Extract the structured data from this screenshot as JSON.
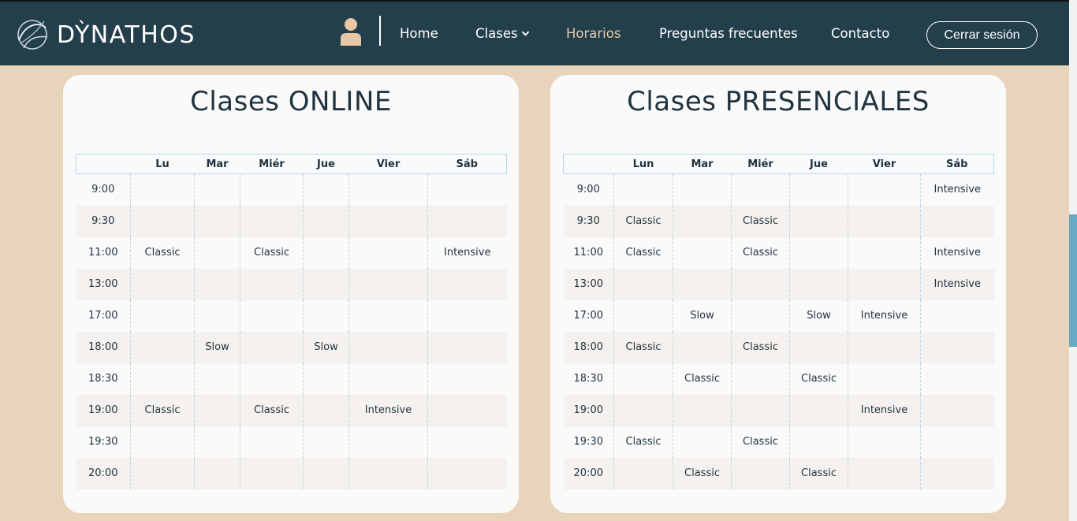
{
  "nav": {
    "brand": "DỲNATHOS",
    "links": {
      "home": "Home",
      "clases": "Clases",
      "horarios": "Horarios",
      "faq": "Preguntas frecuentes",
      "contacto": "Contacto"
    },
    "logout": "Cerrar sesión",
    "active": "horarios",
    "colors": {
      "bar": "#243f4c",
      "active": "#e8c7a6",
      "background": "#e8d3bb"
    }
  },
  "online": {
    "title": "Clases ONLINE",
    "headers": [
      "",
      "Lu",
      "Mar",
      "Miér",
      "Jue",
      "Vier",
      "Sáb"
    ],
    "rows": [
      [
        "9:00",
        "",
        "",
        "",
        "",
        "",
        ""
      ],
      [
        "9:30",
        "",
        "",
        "",
        "",
        "",
        ""
      ],
      [
        "11:00",
        "Classic",
        "",
        "Classic",
        "",
        "",
        "Intensive"
      ],
      [
        "13:00",
        "",
        "",
        "",
        "",
        "",
        ""
      ],
      [
        "17:00",
        "",
        "",
        "",
        "",
        "",
        ""
      ],
      [
        "18:00",
        "",
        "Slow",
        "",
        "Slow",
        "",
        ""
      ],
      [
        "18:30",
        "",
        "",
        "",
        "",
        "",
        ""
      ],
      [
        "19:00",
        "Classic",
        "",
        "Classic",
        "",
        "Intensive",
        ""
      ],
      [
        "19:30",
        "",
        "",
        "",
        "",
        "",
        ""
      ],
      [
        "20:00",
        "",
        "",
        "",
        "",
        "",
        ""
      ]
    ]
  },
  "presencial": {
    "title": "Clases PRESENCIALES",
    "headers": [
      "",
      "Lun",
      "Mar",
      "Miér",
      "Jue",
      "Vier",
      "Sáb"
    ],
    "rows": [
      [
        "9:00",
        "",
        "",
        "",
        "",
        "",
        "Intensive"
      ],
      [
        "9:30",
        "Classic",
        "",
        "Classic",
        "",
        "",
        ""
      ],
      [
        "11:00",
        "Classic",
        "",
        "Classic",
        "",
        "",
        "Intensive"
      ],
      [
        "13:00",
        "",
        "",
        "",
        "",
        "",
        "Intensive"
      ],
      [
        "17:00",
        "",
        "Slow",
        "",
        "Slow",
        "Intensive",
        ""
      ],
      [
        "18:00",
        "Classic",
        "",
        "Classic",
        "",
        "",
        ""
      ],
      [
        "18:30",
        "",
        "Classic",
        "",
        "Classic",
        "",
        ""
      ],
      [
        "19:00",
        "",
        "",
        "",
        "",
        "Intensive",
        ""
      ],
      [
        "19:30",
        "Classic",
        "",
        "Classic",
        "",
        "",
        ""
      ],
      [
        "20:00",
        "",
        "Classic",
        "",
        "Classic",
        "",
        ""
      ]
    ]
  }
}
